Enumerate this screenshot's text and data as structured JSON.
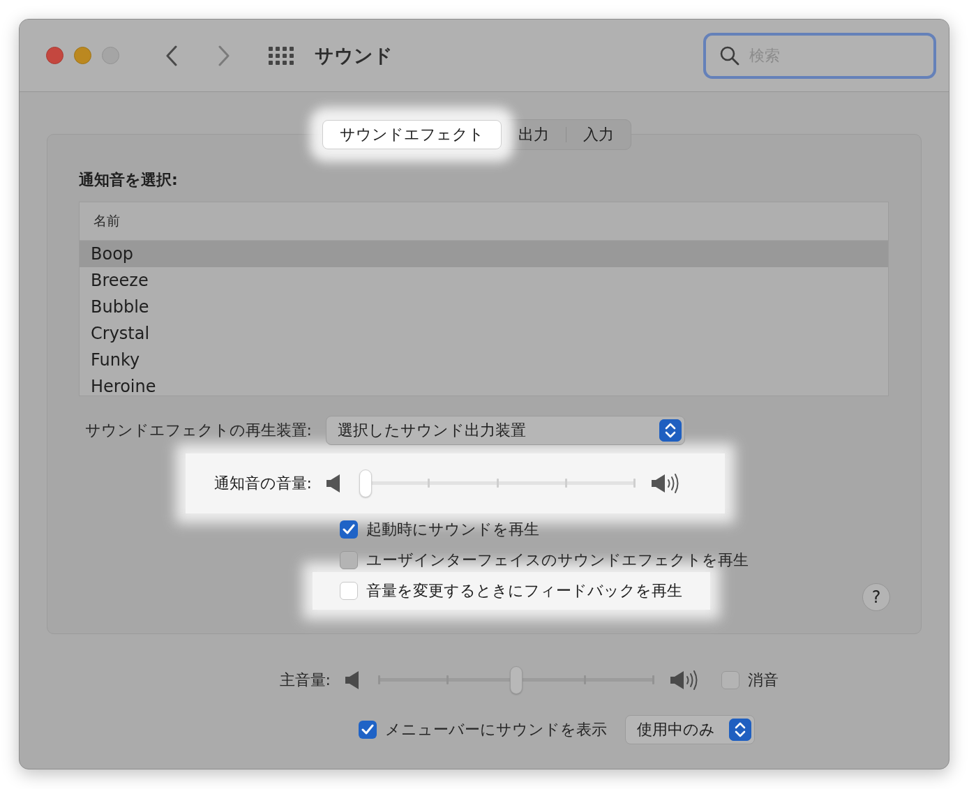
{
  "window": {
    "title": "サウンド"
  },
  "search": {
    "placeholder": "検索",
    "focused": true
  },
  "tabs": [
    {
      "label": "サウンドエフェクト",
      "selected": true,
      "highlighted": true
    },
    {
      "label": "出力",
      "selected": false,
      "highlighted": false
    },
    {
      "label": "入力",
      "selected": false,
      "highlighted": false
    }
  ],
  "alert_sounds": {
    "heading": "通知音を選択:",
    "column": "名前",
    "rows": [
      {
        "name": "Boop",
        "selected": true
      },
      {
        "name": "Breeze",
        "selected": false
      },
      {
        "name": "Bubble",
        "selected": false
      },
      {
        "name": "Crystal",
        "selected": false
      },
      {
        "name": "Funky",
        "selected": false
      },
      {
        "name": "Heroine",
        "selected": false
      }
    ]
  },
  "playback_device": {
    "label": "サウンドエフェクトの再生装置:",
    "value": "選択したサウンド出力装置"
  },
  "alert_volume": {
    "label": "通知音の音量:",
    "level": 0,
    "highlighted": true
  },
  "options": [
    {
      "label": "起動時にサウンドを再生",
      "checked": true,
      "highlighted": false
    },
    {
      "label": "ユーザインターフェイスのサウンドエフェクトを再生",
      "checked": false,
      "highlighted": false
    },
    {
      "label": "音量を変更するときにフィードバックを再生",
      "checked": false,
      "highlighted": true
    }
  ],
  "help": "?",
  "output_volume": {
    "label": "主音量:",
    "level": 0.5,
    "mute": {
      "label": "消音",
      "checked": false
    }
  },
  "menu_bar": {
    "label": "メニューバーにサウンドを表示",
    "checked": true,
    "value": "使用中のみ"
  }
}
